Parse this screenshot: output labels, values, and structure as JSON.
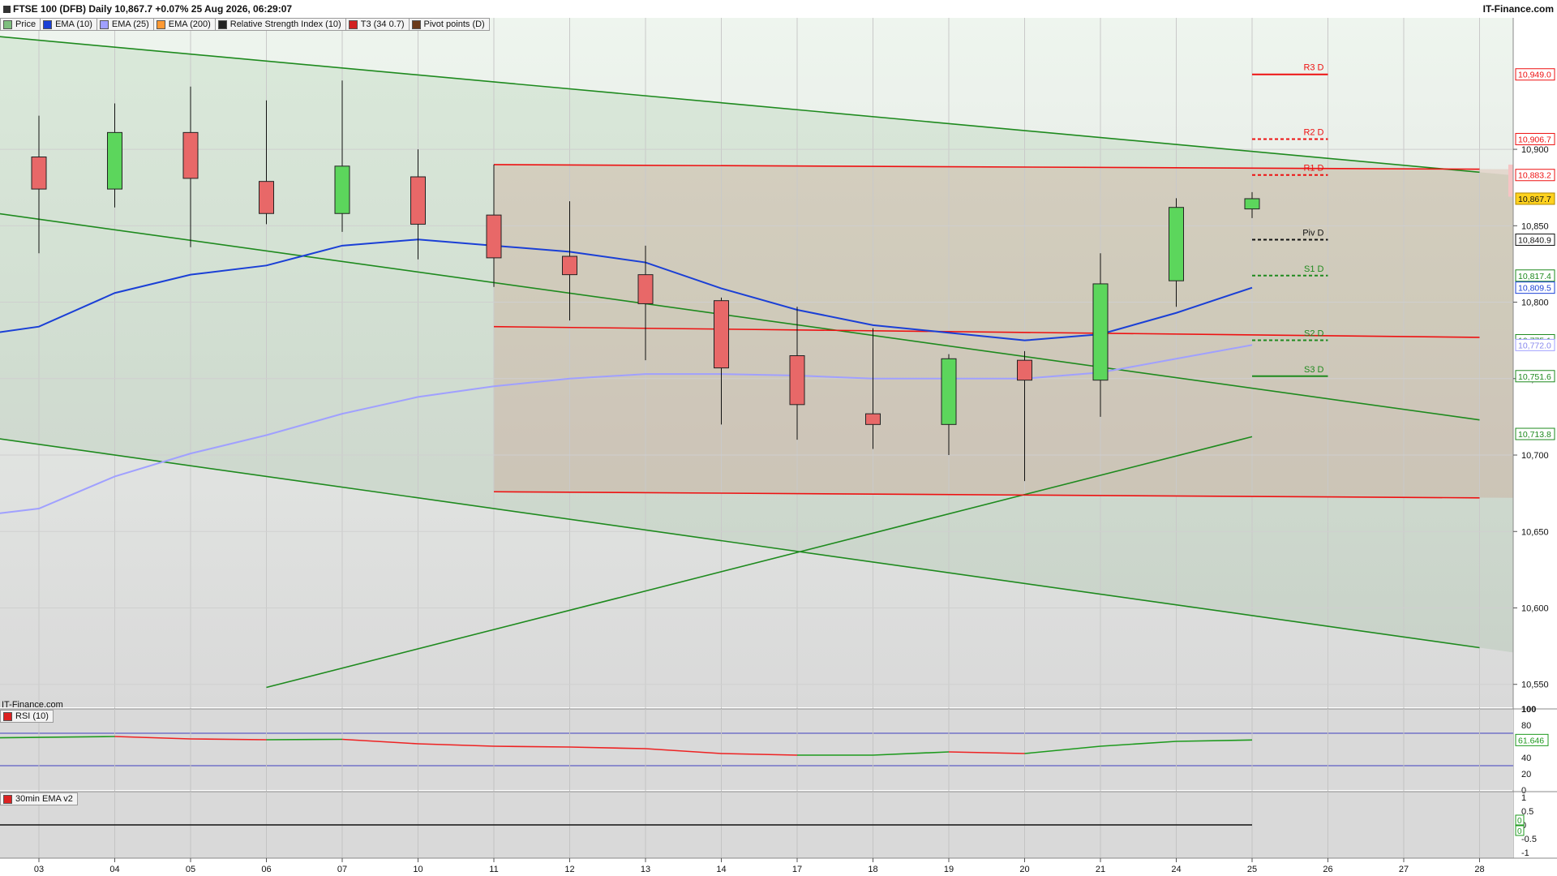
{
  "header": {
    "title": "FTSE 100 (DFB) Daily 10,867.7 +0.07% 25 Aug 2026, 06:29:07",
    "site": "IT-Finance.com",
    "watermark": "IT-Finance.com"
  },
  "legend": [
    {
      "label": "Price",
      "color": "#7fbf7f"
    },
    {
      "label": "EMA (10)",
      "color": "#1a3fd6"
    },
    {
      "label": "EMA (25)",
      "color": "#a0a0ff"
    },
    {
      "label": "EMA (200)",
      "color": "#ff9933"
    },
    {
      "label": "Relative Strength Index (10)",
      "color": "#222222"
    },
    {
      "label": "T3 (34 0.7)",
      "color": "#d22222"
    },
    {
      "label": "Pivot points (D)",
      "color": "#6b3a1a"
    }
  ],
  "panels": {
    "rsi_label": "RSI (10)",
    "ema30_label": "30min EMA v2"
  },
  "colors": {
    "up": "#5cd65c",
    "down": "#e86868",
    "ema10": "#1a3fd6",
    "ema25": "#a0a0ff",
    "trend_green": "#1e8a1e",
    "trend_red": "#ee1111"
  },
  "chart_data": [
    {
      "type": "candlestick",
      "title": "FTSE 100 (DFB) Daily",
      "categories": [
        "03",
        "04",
        "05",
        "06",
        "07",
        "10",
        "11",
        "12",
        "13",
        "14",
        "17",
        "18",
        "19",
        "20",
        "21",
        "24",
        "25",
        "26",
        "27",
        "28"
      ],
      "ylim": [
        10535,
        10986
      ],
      "y_ticks": [
        10550,
        10600,
        10650,
        10700,
        10750,
        10800,
        10850,
        10900
      ],
      "candles": [
        {
          "x": "03",
          "open": 10895,
          "high": 10922,
          "low": 10832,
          "close": 10874
        },
        {
          "x": "04",
          "open": 10874,
          "high": 10930,
          "low": 10862,
          "close": 10911
        },
        {
          "x": "05",
          "open": 10911,
          "high": 10941,
          "low": 10836,
          "close": 10881
        },
        {
          "x": "06",
          "open": 10879,
          "high": 10932,
          "low": 10851,
          "close": 10858
        },
        {
          "x": "07",
          "open": 10858,
          "high": 10945,
          "low": 10846,
          "close": 10889
        },
        {
          "x": "10",
          "open": 10882,
          "high": 10900,
          "low": 10828,
          "close": 10851
        },
        {
          "x": "11",
          "open": 10857,
          "high": 10890,
          "low": 10810,
          "close": 10829
        },
        {
          "x": "12",
          "open": 10830,
          "high": 10866,
          "low": 10788,
          "close": 10818
        },
        {
          "x": "13",
          "open": 10818,
          "high": 10837,
          "low": 10762,
          "close": 10799
        },
        {
          "x": "14",
          "open": 10801,
          "high": 10803,
          "low": 10720,
          "close": 10757
        },
        {
          "x": "17",
          "open": 10765,
          "high": 10797,
          "low": 10710,
          "close": 10733
        },
        {
          "x": "18",
          "open": 10727,
          "high": 10783,
          "low": 10704,
          "close": 10720
        },
        {
          "x": "19",
          "open": 10720,
          "high": 10766,
          "low": 10700,
          "close": 10763
        },
        {
          "x": "20",
          "open": 10762,
          "high": 10768,
          "low": 10683,
          "close": 10749
        },
        {
          "x": "21",
          "open": 10749,
          "high": 10832,
          "low": 10725,
          "close": 10812
        },
        {
          "x": "24",
          "open": 10814,
          "high": 10868,
          "low": 10797,
          "close": 10862
        },
        {
          "x": "25",
          "open": 10861,
          "high": 10872,
          "low": 10855,
          "close": 10867.7
        }
      ],
      "series": [
        {
          "name": "EMA (10)",
          "x": [
            "02",
            "03",
            "04",
            "05",
            "06",
            "07",
            "10",
            "11",
            "12",
            "13",
            "14",
            "17",
            "18",
            "19",
            "20",
            "21",
            "24",
            "25"
          ],
          "values": [
            10777,
            10784,
            10806,
            10818,
            10824,
            10837,
            10841,
            10837,
            10833,
            10826,
            10809,
            10795,
            10785,
            10780,
            10775,
            10779,
            10793,
            10809.5
          ]
        },
        {
          "name": "EMA (25)",
          "x": [
            "02",
            "03",
            "04",
            "05",
            "06",
            "07",
            "10",
            "11",
            "12",
            "13",
            "14",
            "17",
            "18",
            "19",
            "20",
            "21",
            "24",
            "25"
          ],
          "values": [
            10659,
            10665,
            10686,
            10701,
            10713,
            10727,
            10738,
            10745,
            10750,
            10753,
            10753,
            10752,
            10750,
            10750,
            10750,
            10754,
            10763,
            10772
          ]
        }
      ],
      "pivots": [
        {
          "label": "R3 D",
          "value": 10949.0,
          "style": "solid",
          "color": "#ee1111"
        },
        {
          "label": "R2 D",
          "value": 10906.7,
          "style": "dashed",
          "color": "#ee1111"
        },
        {
          "label": "R1 D",
          "value": 10883.2,
          "style": "dashed",
          "color": "#ee1111"
        },
        {
          "label": "Piv D",
          "value": 10840.9,
          "style": "dashed",
          "color": "#111111"
        },
        {
          "label": "S1 D",
          "value": 10817.4,
          "style": "dashed",
          "color": "#1e8a1e"
        },
        {
          "label": "S2 D",
          "value": 10775.1,
          "style": "dashed",
          "color": "#1e8a1e"
        },
        {
          "label": "S3 D",
          "value": 10751.6,
          "style": "solid",
          "color": "#1e8a1e"
        }
      ],
      "price_labels": [
        {
          "text": "10,949.0",
          "value": 10949.0,
          "bg": "#ffffff",
          "border": "#ee1111",
          "color": "#ee1111"
        },
        {
          "text": "10,906.7",
          "value": 10906.7,
          "bg": "#ffffff",
          "border": "#ee1111",
          "color": "#ee1111"
        },
        {
          "text": "10,883.2",
          "value": 10883.2,
          "bg": "#ffffff",
          "border": "#ee1111",
          "color": "#ee1111"
        },
        {
          "text": "10,867.7",
          "value": 10867.7,
          "bg": "#ffd21f",
          "border": "#b08800",
          "color": "#111111"
        },
        {
          "text": "10,840.9",
          "value": 10840.9,
          "bg": "#ffffff",
          "border": "#111111",
          "color": "#111111"
        },
        {
          "text": "10,817.4",
          "value": 10817.4,
          "bg": "#ffffff",
          "border": "#1e8a1e",
          "color": "#1e8a1e"
        },
        {
          "text": "10,809.5",
          "value": 10809.5,
          "bg": "#ffffff",
          "border": "#1a3fd6",
          "color": "#1a3fd6"
        },
        {
          "text": "10,775.1",
          "value": 10775.1,
          "bg": "#ffffff",
          "border": "#1e8a1e",
          "color": "#1e8a1e"
        },
        {
          "text": "10,772.0",
          "value": 10772.0,
          "bg": "#ffffff",
          "border": "#a0a0ff",
          "color": "#8888ee"
        },
        {
          "text": "10,751.6",
          "value": 10751.6,
          "bg": "#ffffff",
          "border": "#1e8a1e",
          "color": "#1e8a1e"
        },
        {
          "text": "10,713.8",
          "value": 10713.8,
          "bg": "#ffffff",
          "border": "#1e8a1e",
          "color": "#1e8a1e"
        }
      ],
      "trendlines": [
        {
          "color": "#1e8a1e",
          "from": [
            "00",
            10985
          ],
          "to": [
            "28",
            10885
          ]
        },
        {
          "color": "#1e8a1e",
          "from": [
            "00",
            10875
          ],
          "to": [
            "28",
            10723
          ]
        },
        {
          "color": "#1e8a1e",
          "from": [
            "00",
            10728
          ],
          "to": [
            "28",
            10574
          ]
        },
        {
          "color": "#1e8a1e",
          "from": [
            "06",
            10548
          ],
          "to": [
            "25",
            10712
          ]
        },
        {
          "color": "#ee1111",
          "from": [
            "11",
            10890
          ],
          "to": [
            "28",
            10887
          ]
        },
        {
          "color": "#ee1111",
          "from": [
            "11",
            10784
          ],
          "to": [
            "28",
            10777
          ]
        },
        {
          "color": "#ee1111",
          "from": [
            "11",
            10676
          ],
          "to": [
            "28",
            10672
          ]
        }
      ]
    },
    {
      "type": "line",
      "title": "RSI (10)",
      "ylim": [
        0,
        100
      ],
      "y_ticks": [
        100,
        80,
        60,
        40,
        20,
        0
      ],
      "levels": [
        70,
        30
      ],
      "current_label": "61.646",
      "x": [
        "02",
        "04",
        "05",
        "06",
        "07",
        "10",
        "11",
        "12",
        "13",
        "14",
        "17",
        "18",
        "19",
        "20",
        "21",
        "24",
        "25"
      ],
      "values": [
        64,
        66,
        63,
        62,
        62.5,
        57,
        54,
        53,
        51,
        45,
        43,
        43,
        47,
        45,
        54,
        60,
        61.646
      ]
    },
    {
      "type": "line",
      "title": "30min EMA v2",
      "ylim": [
        -1.2,
        1.2
      ],
      "y_ticks": [
        1,
        0.5,
        0,
        -0.5,
        -1
      ],
      "current_labels": [
        "0",
        "0"
      ],
      "x": [
        "02",
        "25"
      ],
      "values": [
        0,
        0
      ]
    }
  ]
}
